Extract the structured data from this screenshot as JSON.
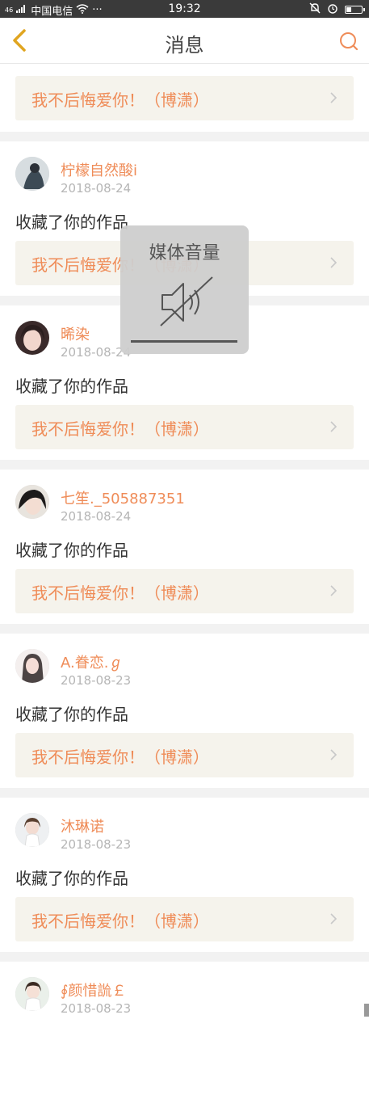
{
  "status_bar": {
    "signal": "46",
    "carrier": "中国电信",
    "dots": "···",
    "time": "19:32"
  },
  "header": {
    "title": "消息"
  },
  "top_card": {
    "work_title": "我不后悔爱你！（博潇）"
  },
  "messages": [
    {
      "user": "柠檬自然酸i",
      "date": "2018-08-24",
      "action": "收藏了你的作品",
      "work_title": "我不后悔爱你！（博潇）"
    },
    {
      "user": "晞染",
      "date": "2018-08-24",
      "action": "收藏了你的作品",
      "work_title": "我不后悔爱你！（博潇）"
    },
    {
      "user": "七笙._505887351",
      "date": "2018-08-24",
      "action": "收藏了你的作品",
      "work_title": "我不后悔爱你！（博潇）"
    },
    {
      "user": "A.眷恋.ℊ",
      "date": "2018-08-23",
      "action": "收藏了你的作品",
      "work_title": "我不后悔爱你！（博潇）"
    },
    {
      "user": "沐琳诺",
      "date": "2018-08-23",
      "action": "收藏了你的作品",
      "work_title": "我不后悔爱你！（博潇）"
    },
    {
      "user": "∮颜惜詤￡",
      "date": "2018-08-23",
      "action": "",
      "work_title": ""
    }
  ],
  "volume_overlay": {
    "title": "媒体音量",
    "level": 0,
    "muted": true
  },
  "colors": {
    "accent": "#ef8c58",
    "back_arrow": "#e0a520",
    "work_box_bg": "#f5f3ec"
  }
}
